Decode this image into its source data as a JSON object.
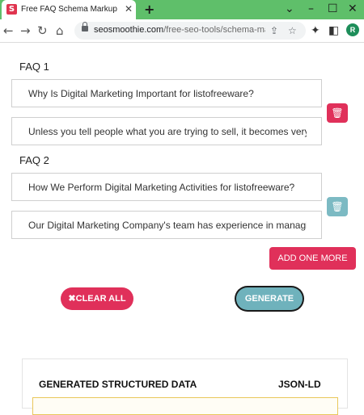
{
  "browser": {
    "tab_title": "Free FAQ Schema Markup Gener",
    "tab_favicon_letter": "S",
    "url_domain": "seosmoothie.com",
    "url_path": "/free-seo-tools/schema-ma...",
    "profile_initial": "R"
  },
  "faqs": [
    {
      "label": "FAQ 1",
      "question": "Why Is Digital Marketing Important for listofreeware?",
      "answer": "Unless you tell people what you are trying to sell, it becomes very difficult"
    },
    {
      "label": "FAQ 2",
      "question": "How We Perform Digital Marketing Activities for listofreeware?",
      "answer": "Our Digital Marketing Company's team has experience in managing Digital"
    }
  ],
  "buttons": {
    "add_more": "ADD ONE MORE",
    "clear_all": "CLEAR ALL",
    "generate": "GENERATE"
  },
  "result": {
    "title": "GENERATED STRUCTURED DATA",
    "format": "JSON-LD"
  },
  "colors": {
    "accent": "#e0305a",
    "teal": "#6fb2bc",
    "tabstrip": "#5fbf6a"
  }
}
